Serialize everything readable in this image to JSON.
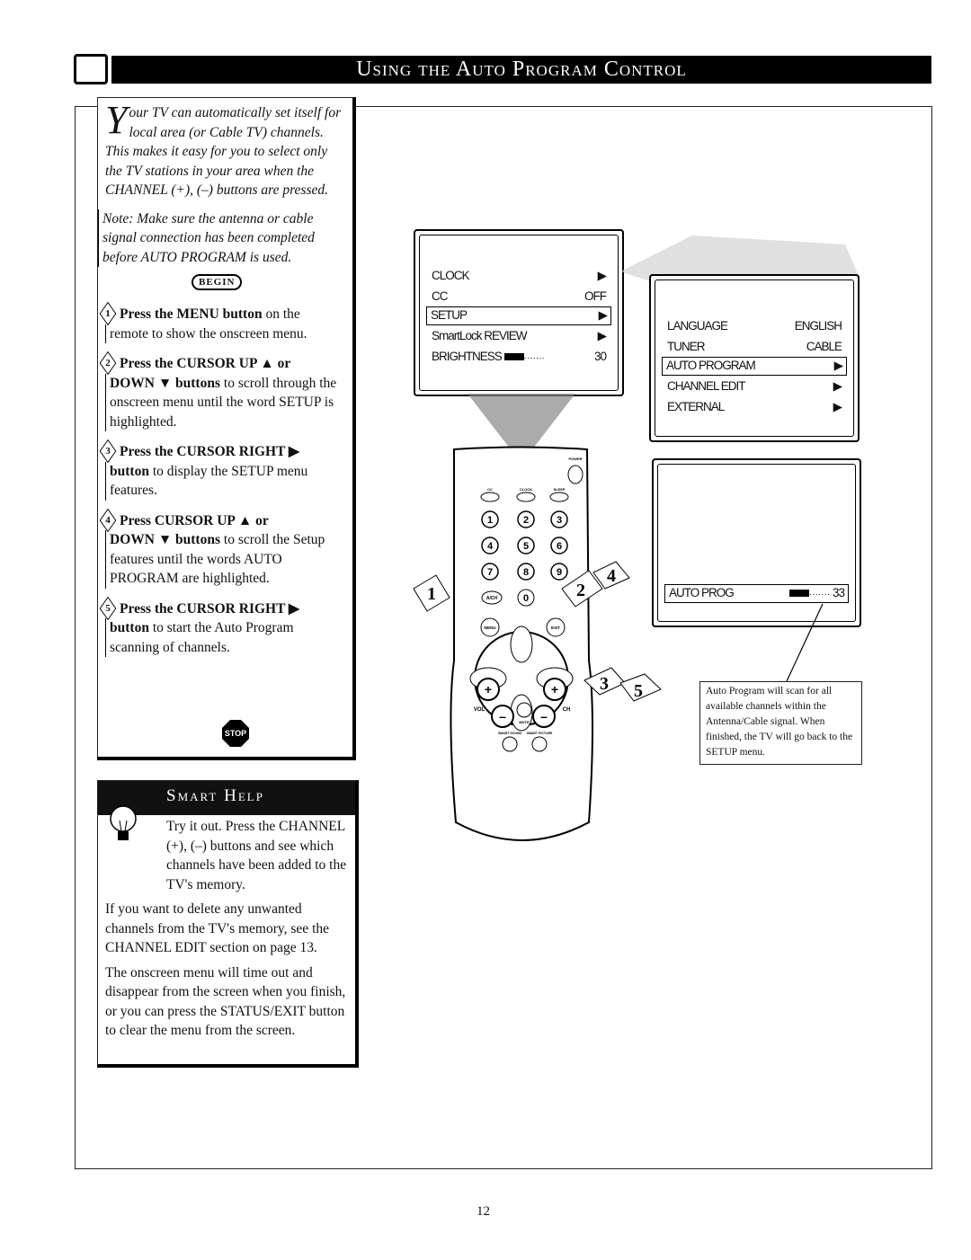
{
  "header": {
    "title": "Using the Auto Program Control"
  },
  "intro": {
    "drop_cap": "Y",
    "text": "our TV can automatically set itself for local area (or Cable TV) channels. This makes it easy for you to select only the TV stations in your area when the CHANNEL (+), (–) buttons are pressed.",
    "note": "Note: Make sure the antenna or cable signal connection has been completed before AUTO PROGRAM is used."
  },
  "begin_label": "BEGIN",
  "steps": [
    {
      "num": "1",
      "head": "Press the MENU button",
      "rest_head": " on the",
      "body": "remote to show the onscreen menu."
    },
    {
      "num": "2",
      "head": "Press the CURSOR UP ▲ or",
      "body_bold": "DOWN ▼ buttons",
      "body": " to scroll through the onscreen menu until the word SETUP is highlighted."
    },
    {
      "num": "3",
      "head": "Press the CURSOR RIGHT ▶",
      "body_bold": "button",
      "body": " to display the SETUP menu features."
    },
    {
      "num": "4",
      "head": "Press CURSOR UP ▲ or",
      "body_bold": "DOWN ▼ buttons",
      "body": " to scroll the Setup features until the words AUTO PROGRAM are highlighted."
    },
    {
      "num": "5",
      "head": "Press the CURSOR RIGHT ▶",
      "body_bold": "button",
      "body": " to start the Auto Program scanning of channels."
    }
  ],
  "stop_label": "STOP",
  "smart_help": {
    "title": "Smart Help",
    "paragraphs": [
      "Try it out. Press the CHANNEL (+), (–) buttons and see which channels have been added to the TV's memory.",
      "If you want to delete any unwanted channels from the TV's memory, see the CHANNEL EDIT section on page 13.",
      "The onscreen menu will time out and disappear from the screen when you finish, or you can press the STATUS/EXIT button to clear the menu from the screen."
    ]
  },
  "main_menu": {
    "items": [
      {
        "label": "CLOCK",
        "value": "▶"
      },
      {
        "label": "CC",
        "value": "OFF"
      },
      {
        "label": "SETUP",
        "value": "▶",
        "selected": true
      },
      {
        "label": "SmartLock REVIEW",
        "value": "▶"
      },
      {
        "label": "BRIGHTNESS",
        "value": "30"
      }
    ],
    "brightness_level": 30
  },
  "setup_menu": {
    "items": [
      {
        "label": "LANGUAGE",
        "value": "ENGLISH"
      },
      {
        "label": "TUNER",
        "value": "CABLE"
      },
      {
        "label": "AUTO PROGRAM",
        "value": "▶",
        "selected": true
      },
      {
        "label": "CHANNEL EDIT",
        "value": "▶"
      },
      {
        "label": "EXTERNAL",
        "value": "▶"
      }
    ]
  },
  "auto_prog": {
    "label": "AUTO PROG",
    "value": "33"
  },
  "caption": "Auto Program will scan for all available channels within the Antenna/Cable signal. When finished, the TV will go back to the SETUP menu.",
  "remote": {
    "power": "POWER",
    "cc": "CC",
    "clock": "CLOCK",
    "sleep": "SLEEP",
    "digits": [
      "1",
      "2",
      "3",
      "4",
      "5",
      "6",
      "7",
      "8",
      "9"
    ],
    "ach": "A/CH",
    "zero": "0",
    "menu": "MENU",
    "exit": "EXIT",
    "vol": "VOL",
    "ch": "CH",
    "mute": "MUTE",
    "smart_sound": "SMART SOUND",
    "smart_picture": "SMART PICTURE",
    "callouts": [
      "1",
      "2",
      "4",
      "3",
      "5"
    ]
  },
  "page_number": "12"
}
